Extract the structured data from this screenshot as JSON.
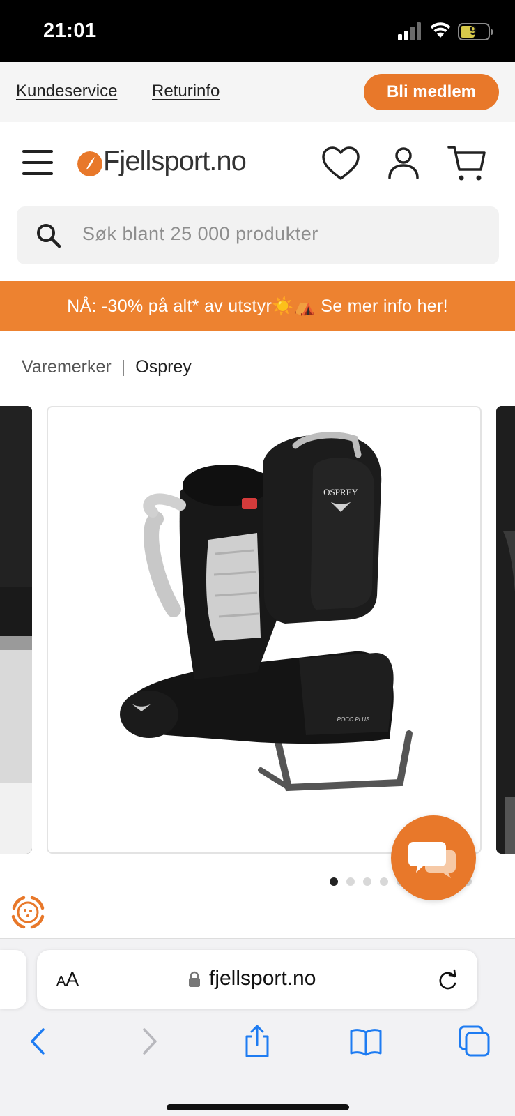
{
  "status_bar": {
    "time": "21:01",
    "battery": "9"
  },
  "top_links": {
    "customer_service": "Kundeservice",
    "returns": "Returinfo",
    "member_button": "Bli medlem"
  },
  "header": {
    "logo_text": "Fjellsport.no"
  },
  "search": {
    "placeholder": "Søk blant 25 000 produkter"
  },
  "promo": {
    "text": "NÅ: -30% på alt* av utstyr☀️⛺ Se mer info her!"
  },
  "breadcrumb": {
    "items": [
      "Varemerker",
      "Osprey"
    ]
  },
  "gallery": {
    "image_count": 10,
    "active_index": 0,
    "product_logo": "OSPREY",
    "product_label": "POCO PLUS"
  },
  "browser": {
    "aa_label": "AA",
    "url": "fjellsport.no"
  },
  "colors": {
    "accent": "#e8782a",
    "promo": "#ed8230",
    "ios_blue": "#1e7cf2"
  }
}
